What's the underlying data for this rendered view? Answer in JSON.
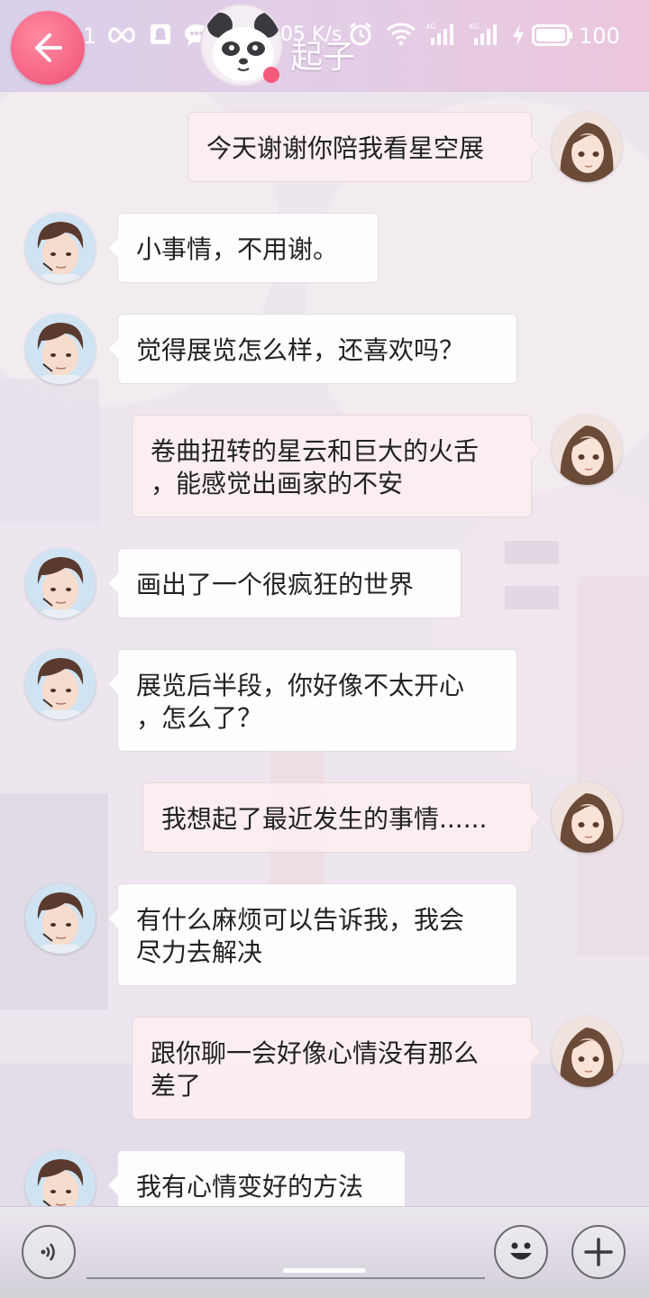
{
  "status_bar": {
    "time": "06:11",
    "net_speed": "0.05 K/s",
    "battery": "100"
  },
  "header": {
    "title": "起子",
    "back_icon": "arrow-left-icon",
    "avatar_icon": "panda-avatar-icon"
  },
  "messages": [
    {
      "side": "right",
      "text": "今天谢谢你陪我看星空展"
    },
    {
      "side": "left",
      "text": "小事情，不用谢。"
    },
    {
      "side": "left",
      "text": "觉得展览怎么样，还喜欢吗？"
    },
    {
      "side": "right",
      "line1": "卷曲扭转的星云和巨大的火舌",
      "line2": "，能感觉出画家的不安"
    },
    {
      "side": "left",
      "text": "画出了一个很疯狂的世界"
    },
    {
      "side": "left",
      "line1": "展览后半段，你好像不太开心",
      "line2": "，怎么了？"
    },
    {
      "side": "right",
      "text": "我想起了最近发生的事情......"
    },
    {
      "side": "left",
      "line1": "有什么麻烦可以告诉我，我会",
      "line2": "尽力去解决"
    },
    {
      "side": "right",
      "line1": "跟你聊一会好像心情没有那么",
      "line2": "差了"
    },
    {
      "side": "left",
      "text": "我有心情变好的方法"
    }
  ],
  "input_bar": {
    "voice_icon": "voice-icon",
    "emoji_icon": "emoji-icon",
    "plus_icon": "plus-icon"
  },
  "colors": {
    "back_button": "#f46283",
    "left_bubble": "#ffffff",
    "right_bubble": "#fceef0"
  }
}
